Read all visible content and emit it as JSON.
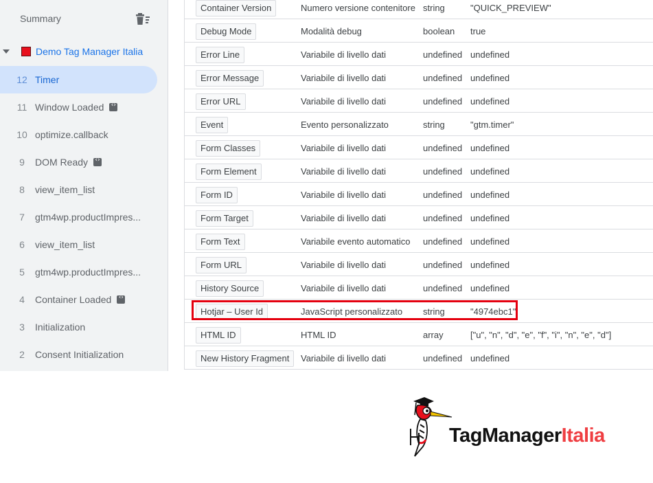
{
  "sidebar": {
    "title": "Summary",
    "clear_icon": "delete-sweep-icon",
    "container": {
      "name": "Demo Tag Manager Italia",
      "color": "#e8101d",
      "expanded": true
    },
    "events": [
      {
        "num": "12",
        "label": "Timer",
        "selected": true,
        "badge": false
      },
      {
        "num": "11",
        "label": "Window Loaded",
        "selected": false,
        "badge": true
      },
      {
        "num": "10",
        "label": "optimize.callback",
        "selected": false,
        "badge": false
      },
      {
        "num": "9",
        "label": "DOM Ready",
        "selected": false,
        "badge": true
      },
      {
        "num": "8",
        "label": "view_item_list",
        "selected": false,
        "badge": false
      },
      {
        "num": "7",
        "label": "gtm4wp.productImpres...",
        "selected": false,
        "badge": false
      },
      {
        "num": "6",
        "label": "view_item_list",
        "selected": false,
        "badge": false
      },
      {
        "num": "5",
        "label": "gtm4wp.productImpres...",
        "selected": false,
        "badge": false
      },
      {
        "num": "4",
        "label": "Container Loaded",
        "selected": false,
        "badge": true
      },
      {
        "num": "3",
        "label": "Initialization",
        "selected": false,
        "badge": false
      },
      {
        "num": "2",
        "label": "Consent Initialization",
        "selected": false,
        "badge": false
      }
    ]
  },
  "variables": [
    {
      "name": "Container Version",
      "type": "Numero versione contenitore",
      "return": "string",
      "value": "\"QUICK_PREVIEW\""
    },
    {
      "name": "Debug Mode",
      "type": "Modalità debug",
      "return": "boolean",
      "value": "true"
    },
    {
      "name": "Error Line",
      "type": "Variabile di livello dati",
      "return": "undefined",
      "value": "undefined"
    },
    {
      "name": "Error Message",
      "type": "Variabile di livello dati",
      "return": "undefined",
      "value": "undefined"
    },
    {
      "name": "Error URL",
      "type": "Variabile di livello dati",
      "return": "undefined",
      "value": "undefined"
    },
    {
      "name": "Event",
      "type": "Evento personalizzato",
      "return": "string",
      "value": "\"gtm.timer\""
    },
    {
      "name": "Form Classes",
      "type": "Variabile di livello dati",
      "return": "undefined",
      "value": "undefined"
    },
    {
      "name": "Form Element",
      "type": "Variabile di livello dati",
      "return": "undefined",
      "value": "undefined"
    },
    {
      "name": "Form ID",
      "type": "Variabile di livello dati",
      "return": "undefined",
      "value": "undefined"
    },
    {
      "name": "Form Target",
      "type": "Variabile di livello dati",
      "return": "undefined",
      "value": "undefined"
    },
    {
      "name": "Form Text",
      "type": "Variabile evento automatico",
      "return": "undefined",
      "value": "undefined"
    },
    {
      "name": "Form URL",
      "type": "Variabile di livello dati",
      "return": "undefined",
      "value": "undefined"
    },
    {
      "name": "History Source",
      "type": "Variabile di livello dati",
      "return": "undefined",
      "value": "undefined"
    },
    {
      "name": "Hotjar – User Id",
      "type": "JavaScript personalizzato",
      "return": "string",
      "value": "\"4974ebc1\"",
      "highlighted": true
    },
    {
      "name": "HTML ID",
      "type": "HTML ID",
      "return": "array",
      "value": "[\"u\", \"n\", \"d\", \"e\", \"f\", \"i\", \"n\", \"e\", \"d\"]"
    },
    {
      "name": "New History Fragment",
      "type": "Variabile di livello dati",
      "return": "undefined",
      "value": "undefined"
    }
  ],
  "highlight_color": "#e4000f",
  "logo": {
    "part1": "TagManager",
    "part2": "Italia",
    "icon": "woodpecker-mascot-icon"
  }
}
